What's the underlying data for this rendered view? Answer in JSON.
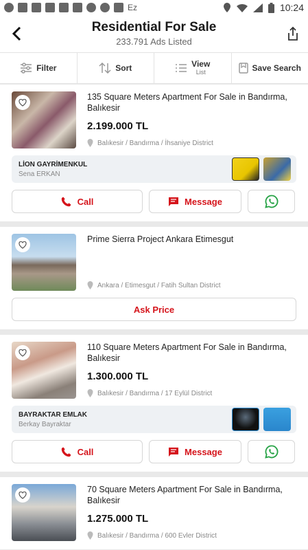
{
  "status": {
    "time": "10:24",
    "ez": "Ez"
  },
  "header": {
    "title": "Residential For Sale",
    "subtitle": "233.791 Ads Listed"
  },
  "toolbar": {
    "filter": "Filter",
    "sort": "Sort",
    "view": "View",
    "view_sub": "List",
    "save_search": "Save Search"
  },
  "colors": {
    "accent_red": "#d5141b",
    "whatsapp_green": "#25a244"
  },
  "listings": [
    {
      "title": "135 Square Meters Apartment For Sale in Bandırma, Balıkesir",
      "price": "2.199.000 TL",
      "location": "Balıkesir / Bandırma / İhsaniye District",
      "agency_name": "LİON GAYRİMENKUL",
      "agency_person": "Sena ERKAN",
      "call": "Call",
      "message": "Message"
    },
    {
      "title": "Prime Sierra Project Ankara Etimesgut",
      "location": "Ankara / Etimesgut / Fatih Sultan District",
      "ask_price": "Ask Price"
    },
    {
      "title": "110 Square Meters Apartment For Sale in Bandırma, Balıkesir",
      "price": "1.300.000 TL",
      "location": "Balıkesir / Bandırma / 17 Eylül District",
      "agency_name": "BAYRAKTAR EMLAK",
      "agency_person": "Berkay Bayraktar",
      "call": "Call",
      "message": "Message"
    },
    {
      "title": "70 Square Meters Apartment For Sale in Bandırma, Balıkesir",
      "price": "1.275.000 TL",
      "location": "Balıkesir / Bandırma / 600 Evler District"
    }
  ]
}
